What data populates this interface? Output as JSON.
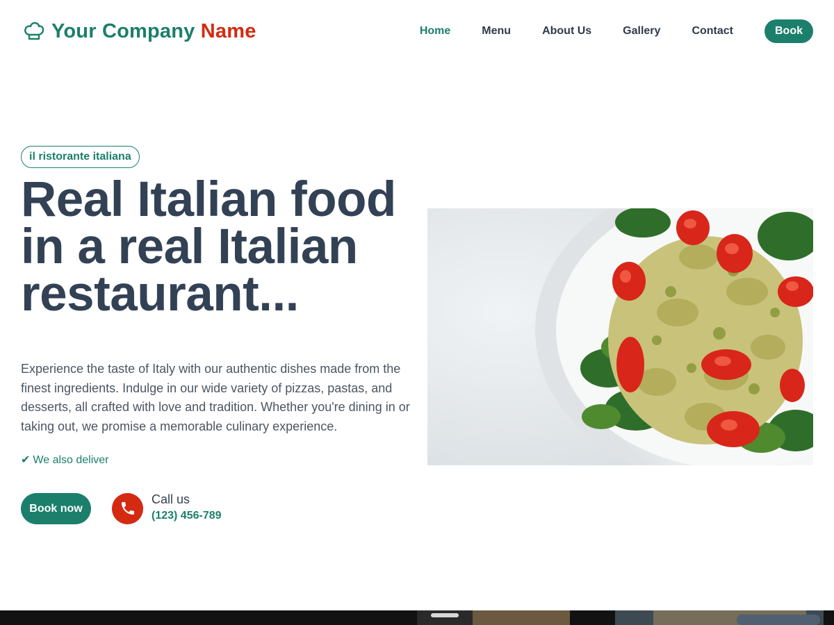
{
  "header": {
    "brand_primary": "Your Company",
    "brand_accent": "Name",
    "logo_icon": "chef-hat-icon",
    "nav": [
      {
        "label": "Home",
        "active": true
      },
      {
        "label": "Menu",
        "active": false
      },
      {
        "label": "About Us",
        "active": false
      },
      {
        "label": "Gallery",
        "active": false
      },
      {
        "label": "Contact",
        "active": false
      }
    ],
    "book_label": "Book"
  },
  "hero": {
    "badge": "il ristorante italiana",
    "headline": "Real Italian food in a real Italian restaurant...",
    "description": "Experience the taste of Italy with our authentic dishes made from the finest ingredients. Indulge in our wide variety of pizzas, pastas, and desserts, all crafted with love and tradition. Whether you're dining in or taking out, we promise a memorable culinary experience.",
    "deliver_check": "✔",
    "deliver_text": "We also deliver",
    "book_now": "Book now",
    "call_label": "Call us",
    "phone_number": "(123) 456-789",
    "phone_icon": "phone-icon",
    "image_subject": "farfalle-pesto-salad-with-cherry-tomatoes"
  },
  "colors": {
    "brand_green": "#1b7f6b",
    "accent_red": "#d42a12",
    "heading": "#334155",
    "body_text": "#4b5563"
  }
}
